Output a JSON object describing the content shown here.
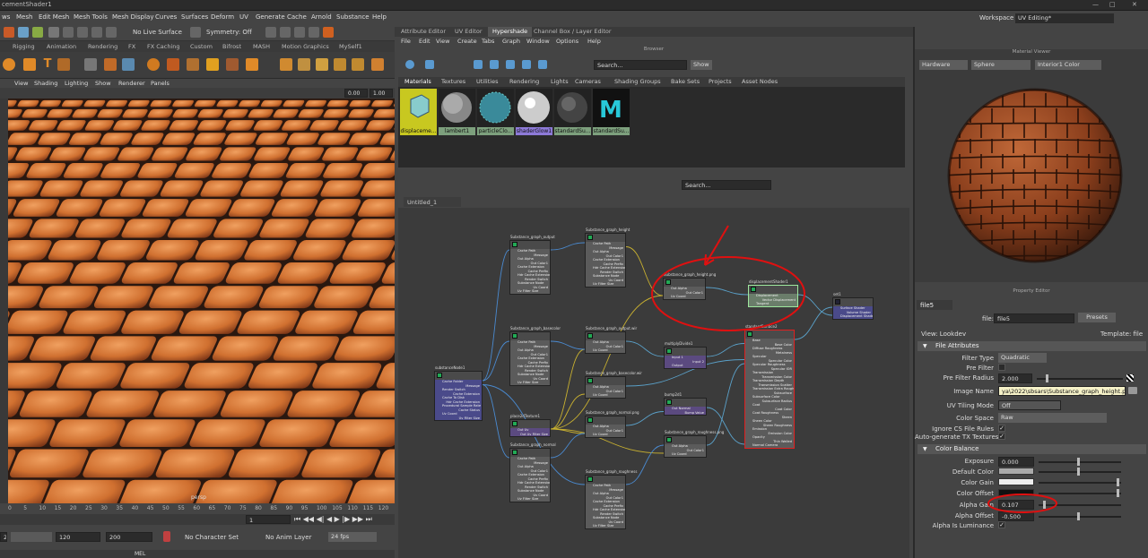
{
  "window": {
    "title": "cementShader1"
  },
  "main_menu": [
    "ws",
    "Mesh",
    "Edit Mesh",
    "Mesh Tools",
    "Mesh Display",
    "Curves",
    "Surfaces",
    "Deform",
    "UV",
    "Generate",
    "Cache",
    "Arnold",
    "Substance",
    "Help"
  ],
  "workspace": {
    "label": "Workspace :",
    "value": "UV Editing*"
  },
  "status_line": {
    "live_surface": "No Live Surface",
    "symmetry": "Symmetry: Off"
  },
  "shelf_tabs": [
    "Rigging",
    "Animation",
    "Rendering",
    "FX",
    "FX Caching",
    "Custom",
    "Bifrost",
    "MASH",
    "Motion Graphics",
    "MySelf1"
  ],
  "viewport": {
    "menu": [
      "View",
      "Shading",
      "Lighting",
      "Show",
      "Renderer",
      "Panels"
    ],
    "value1": "0.00",
    "value2": "1.00",
    "camera_label": "persp"
  },
  "timeline": {
    "ticks": [
      "0",
      "5",
      "10",
      "15",
      "20",
      "25",
      "30",
      "35",
      "40",
      "45",
      "50",
      "55",
      "60",
      "65",
      "70",
      "75",
      "80",
      "85",
      "90",
      "95",
      "100",
      "105",
      "110",
      "115",
      "120"
    ],
    "current_frame": "1"
  },
  "range": {
    "start": "20",
    "end": "120",
    "end2": "200",
    "character_set": "No Character Set",
    "anim_layer": "No Anim Layer",
    "fps": "24 fps"
  },
  "command_line": {
    "label": "MEL"
  },
  "editor_tabs": [
    "Attribute Editor",
    "UV Editor",
    "Hypershade",
    "Channel Box / Layer Editor"
  ],
  "hypershade": {
    "menu": [
      "File",
      "Edit",
      "View",
      "Create",
      "Tabs",
      "Graph",
      "Window",
      "Options",
      "Help"
    ],
    "browser_title": "Browser",
    "search_placeholder": "Search...",
    "show_label": "Show",
    "material_tabs": [
      "Materials",
      "Textures",
      "Utilities",
      "Rendering",
      "Lights",
      "Cameras",
      "Shading Groups",
      "Bake Sets",
      "Projects",
      "Asset Nodes"
    ],
    "swatches": [
      {
        "label": "displaceme...",
        "bg": "#c8c820"
      },
      {
        "label": "lambert1",
        "bg": "#7da07d"
      },
      {
        "label": "particleClo...",
        "bg": "#7da07d"
      },
      {
        "label": "shaderGlow1",
        "bg": "#8d7ad8"
      },
      {
        "label": "standardSu...",
        "bg": "#7da07d"
      },
      {
        "label": "standardSu...",
        "bg": "#7da07d"
      }
    ],
    "graph_search_placeholder": "Search...",
    "graph_tab": "Untitled_1",
    "nodes": [
      {
        "title": "Substance_graph_output",
        "rows": [
          "Cache Path",
          "Message",
          "Out Alpha",
          "Out Color1",
          "Cache Extension",
          "Cache Prefix",
          "Hdr Cache Extension",
          "Render Switch",
          "Substance Node",
          "Uv Coord",
          "Uv Filter Size"
        ],
        "color": "#5b5b5b"
      },
      {
        "title": "Substance_graph_height",
        "rows": [
          "Cache Path",
          "Message",
          "Out Alpha",
          "Out Color1",
          "Cache Extension",
          "Cache Prefix",
          "Hdr Cache Extension",
          "Render Switch",
          "Substance Node",
          "Uv Coord",
          "Uv Filter Size"
        ],
        "color": "#5b5b5b"
      },
      {
        "title": "Substance_graph_height.png",
        "rows": [
          "Out Alpha",
          "Out Color1",
          "Uv Coord"
        ],
        "color": "#5b5b5b"
      },
      {
        "title": "displacementShader1",
        "rows": [
          "Displacement",
          "Vector Displacement",
          "Tangent"
        ],
        "color": "#6a7d6a"
      },
      {
        "title": "set1",
        "rows": [
          "Surface Shader",
          "Volume Shader",
          "Displacement Shader"
        ],
        "color": "#4a4a8a"
      },
      {
        "title": "Substance_graph_basecolor",
        "rows": [
          "Cache Path",
          "Message",
          "Out Alpha",
          "Out Color1",
          "Cache Extension",
          "Cache Prefix",
          "Hdr Cache Extension",
          "Render Switch",
          "Substance Node",
          "Uv Coord",
          "Uv Filter Size"
        ],
        "color": "#5b5b5b"
      },
      {
        "title": "Substance_graph_output.wir",
        "rows": [
          "Out Alpha",
          "Out Color1",
          "Uv Coord"
        ],
        "color": "#5b5b5b"
      },
      {
        "title": "multiplyDivide1",
        "rows": [
          "Input 1",
          "Input 2",
          "Output"
        ],
        "color": "#5b4a80"
      },
      {
        "title": "standardSurface2",
        "rows": [
          "Base",
          "Base Color",
          "Diffuse Roughness",
          "Metalness",
          "Specular",
          "Specular Color",
          "Specular Roughness",
          "Specular IOR",
          "Transmission",
          "Transmission Color",
          "Transmission Depth",
          "Transmission Scatter",
          "Transmission Extra Roughness",
          "Subsurface",
          "Subsurface Color",
          "Subsurface Radius",
          "Coat",
          "Coat Color",
          "Coat Roughness",
          "Sheen",
          "Sheen Color",
          "Sheen Roughness",
          "Emission",
          "Emission Color",
          "Opacity",
          "Thin Walled",
          "Normal Camera"
        ],
        "color": "#5b5b5b"
      },
      {
        "title": "substanceNode1",
        "rows": [
          "Cache Folder",
          "Message",
          "Render Switch",
          "Cache Extension",
          "Cache To Disk",
          "Hdr Cache Extension",
          "Procedural Sample Rate",
          "Cache Status",
          "Uv Coord",
          "Uv Filter Size"
        ],
        "color": "#4a4a8a"
      },
      {
        "title": "Substance_graph_basecolor.wir",
        "rows": [
          "Out Alpha",
          "Out Color1",
          "Uv Coord"
        ],
        "color": "#5b5b5b"
      },
      {
        "title": "place2dTexture1",
        "rows": [
          "Out Uv",
          "Out Uv Filter Size"
        ],
        "color": "#5b4a80"
      },
      {
        "title": "Substance_graph_normal.png",
        "rows": [
          "Out Alpha",
          "Out Color1",
          "Uv Coord"
        ],
        "color": "#5b5b5b"
      },
      {
        "title": "bump2d1",
        "rows": [
          "Out Normal",
          "Bump Value"
        ],
        "color": "#5b4a80"
      },
      {
        "title": "Substance_graph_roughness.png",
        "rows": [
          "Out Alpha",
          "Out Color1",
          "Uv Coord"
        ],
        "color": "#5b5b5b"
      },
      {
        "title": "Substance_graph_normal",
        "rows": [
          "Cache Path",
          "Message",
          "Out Alpha",
          "Out Color1",
          "Cache Extension",
          "Cache Prefix",
          "Hdr Cache Extension",
          "Render Switch",
          "Substance Node",
          "Uv Coord",
          "Uv Filter Size"
        ],
        "color": "#5b5b5b"
      },
      {
        "title": "Substance_graph_roughness",
        "rows": [
          "Cache Path",
          "Message",
          "Out Alpha",
          "Out Color1",
          "Cache Extension",
          "Cache Prefix",
          "Hdr Cache Extension",
          "Render Switch",
          "Substance Node",
          "Uv Coord",
          "Uv Filter Size"
        ],
        "color": "#5b5b5b"
      }
    ]
  },
  "material_viewer": {
    "title": "Material Viewer",
    "renderer": "Hardware",
    "geometry": "Sphere",
    "environment": "Interior1 Color"
  },
  "property_editor": {
    "title": "Property Editor",
    "node_tab": "file5",
    "file_label": "file:",
    "file_value": "file5",
    "presets": "Presets",
    "view_label": "View: Lookdev",
    "template_label": "Template: file",
    "section_file": "File Attributes",
    "filter_type_label": "Filter Type",
    "filter_type": "Quadratic",
    "pre_filter_label": "Pre Filter",
    "pre_filter_radius_label": "Pre Filter Radius",
    "pre_filter_radius": "2.000",
    "image_name_label": "Image Name",
    "image_name": "ya\\2022\\sbsars\\Substance_graph_height.png",
    "uv_tiling_label": "UV Tiling Mode",
    "uv_tiling": "Off",
    "color_space_label": "Color Space",
    "color_space": "Raw",
    "ignore_cs_label": "Ignore CS File Rules",
    "auto_tx_label": "Auto-generate TX Textures",
    "section_color": "Color Balance",
    "exposure_label": "Exposure",
    "exposure": "0.000",
    "default_color_label": "Default Color",
    "color_gain_label": "Color Gain",
    "color_offset_label": "Color Offset",
    "alpha_gain_label": "Alpha Gain",
    "alpha_gain": "0.107",
    "alpha_offset_label": "Alpha Offset",
    "alpha_offset": "-0.500",
    "alpha_lum_label": "Alpha Is Luminance"
  }
}
